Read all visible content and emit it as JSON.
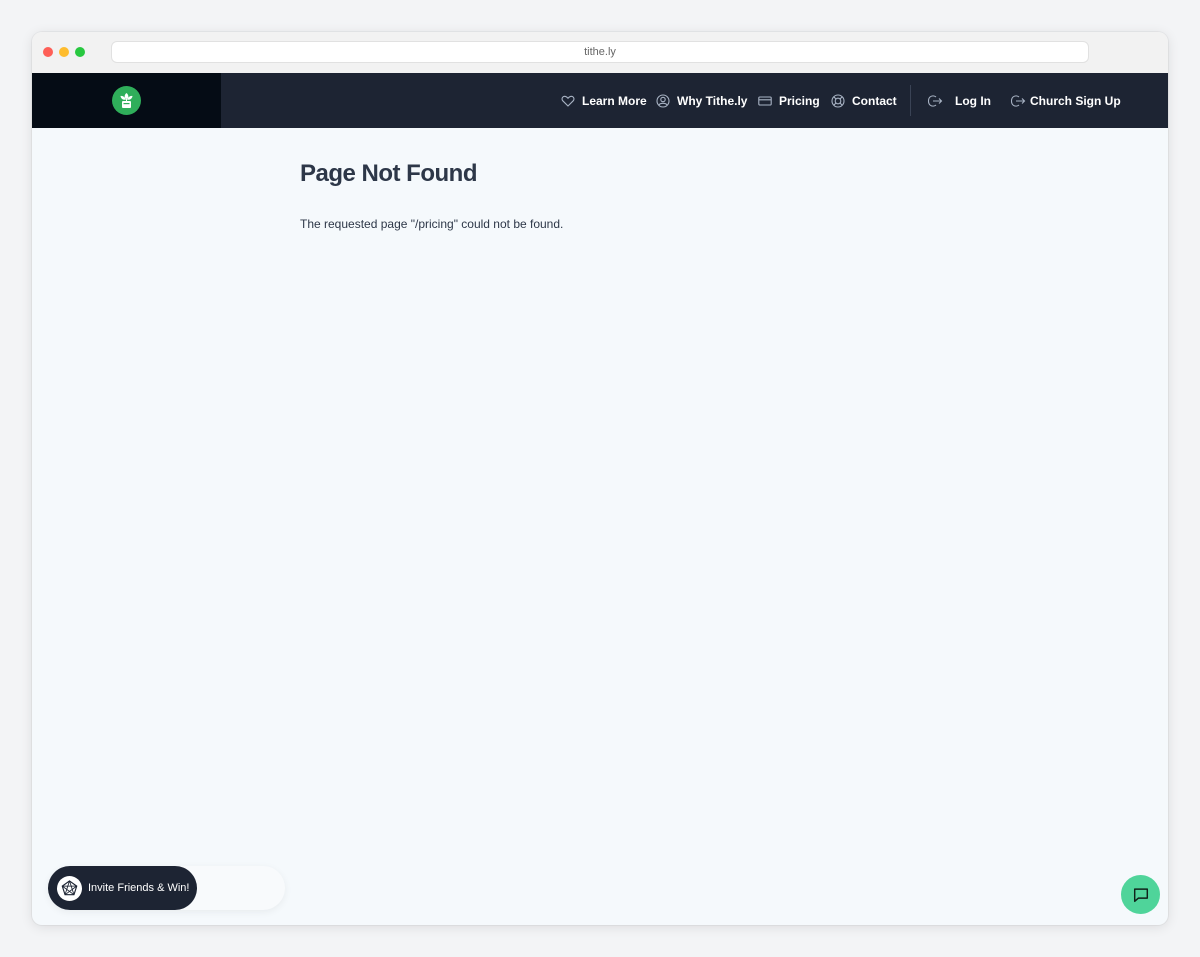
{
  "browser": {
    "url": "tithe.ly"
  },
  "nav": {
    "learn_more": "Learn More",
    "why": "Why Tithe.ly",
    "pricing": "Pricing",
    "contact": "Contact",
    "login": "Log In",
    "signup": "Church Sign Up"
  },
  "page": {
    "title": "Page Not Found",
    "message": "The requested page \"/pricing\" could not be found."
  },
  "invite": {
    "label": "Invite Friends & Win!"
  },
  "colors": {
    "nav_bg": "#1d2433",
    "logo_green": "#2fae5a",
    "chat_green": "#4fd49a",
    "text_dark": "#2d3748"
  },
  "icons": [
    "heart-icon",
    "user-circle-icon",
    "credit-card-icon",
    "life-buoy-icon",
    "logout-icon",
    "chat-icon",
    "network-icon"
  ]
}
